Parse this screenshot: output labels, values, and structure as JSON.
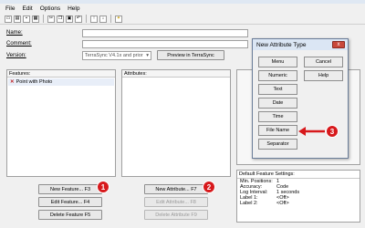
{
  "menu": [
    "File",
    "Edit",
    "Options",
    "Help"
  ],
  "toolbar": {
    "icons": [
      "new-icon",
      "open-icon",
      "save-icon",
      "print-icon",
      "cut-icon",
      "copy-icon",
      "paste-icon",
      "undo-icon",
      "move-up-icon",
      "move-down-icon",
      "bulb-icon"
    ]
  },
  "form": {
    "name_label": "Name:",
    "comment_label": "Comment:",
    "version_label": "Version:",
    "version_value": "TerraSync V4.1x and prior",
    "preview_button": "Preview in TerraSync"
  },
  "features": {
    "header": "Features:",
    "items": [
      {
        "label": "Point with Photo"
      }
    ]
  },
  "attributes": {
    "header": "Attributes:"
  },
  "buttons": {
    "new_feature": "New Feature... F3",
    "edit_feature": "Edit Feature... F4",
    "delete_feature": "Delete Feature F5",
    "new_attribute": "New Attribute... F7",
    "edit_attribute": "Edit Attribute... F8",
    "delete_attribute": "Delete Attribute F9"
  },
  "dialog": {
    "title": "New Attribute Type",
    "close": "x",
    "types": [
      "Menu",
      "Numeric",
      "Text",
      "Date",
      "Time",
      "File Name",
      "Separator"
    ],
    "cancel": "Cancel",
    "help": "Help"
  },
  "settings": {
    "title": "Default Feature Settings:",
    "rows": [
      {
        "key": "Min. Positions:",
        "value": "1"
      },
      {
        "key": "Accuracy:",
        "value": "Code"
      },
      {
        "key": "Log Interval:",
        "value": "1 seconds"
      },
      {
        "key": "Label 1:",
        "value": "<Off>"
      },
      {
        "key": "Label 2:",
        "value": "<Off>"
      }
    ]
  },
  "callouts": [
    "1",
    "2",
    "3"
  ],
  "colors": {
    "callout": "#d7191c",
    "dialog_title": "#dbe6f4",
    "close": "#c9483b"
  }
}
